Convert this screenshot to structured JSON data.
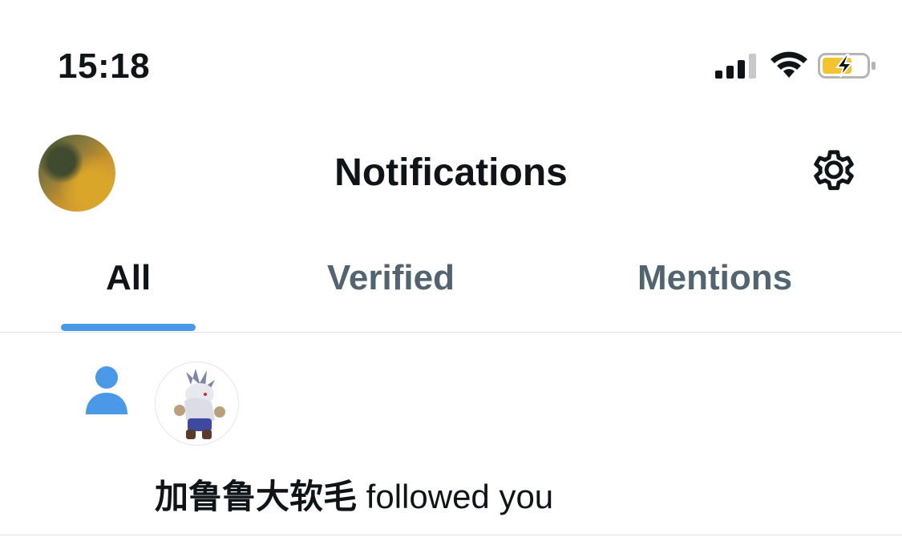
{
  "status_bar": {
    "time": "15:18",
    "icons": [
      "signal-icon",
      "wifi-icon",
      "battery-charging-icon"
    ],
    "battery_color": "#f4c430"
  },
  "header": {
    "title": "Notifications",
    "avatar_icon": "profile-avatar",
    "settings_icon": "gear-icon"
  },
  "tabs": [
    {
      "label": "All",
      "active": true
    },
    {
      "label": "Verified",
      "active": false
    },
    {
      "label": "Mentions",
      "active": false
    }
  ],
  "colors": {
    "accent": "#4a99e9",
    "text_primary": "#0f1419",
    "text_secondary": "#536471",
    "divider": "#dfe3e6"
  },
  "notifications": [
    {
      "type_icon": "person-follow-icon",
      "username": "加鲁鲁大软毛",
      "action": " followed you"
    }
  ]
}
